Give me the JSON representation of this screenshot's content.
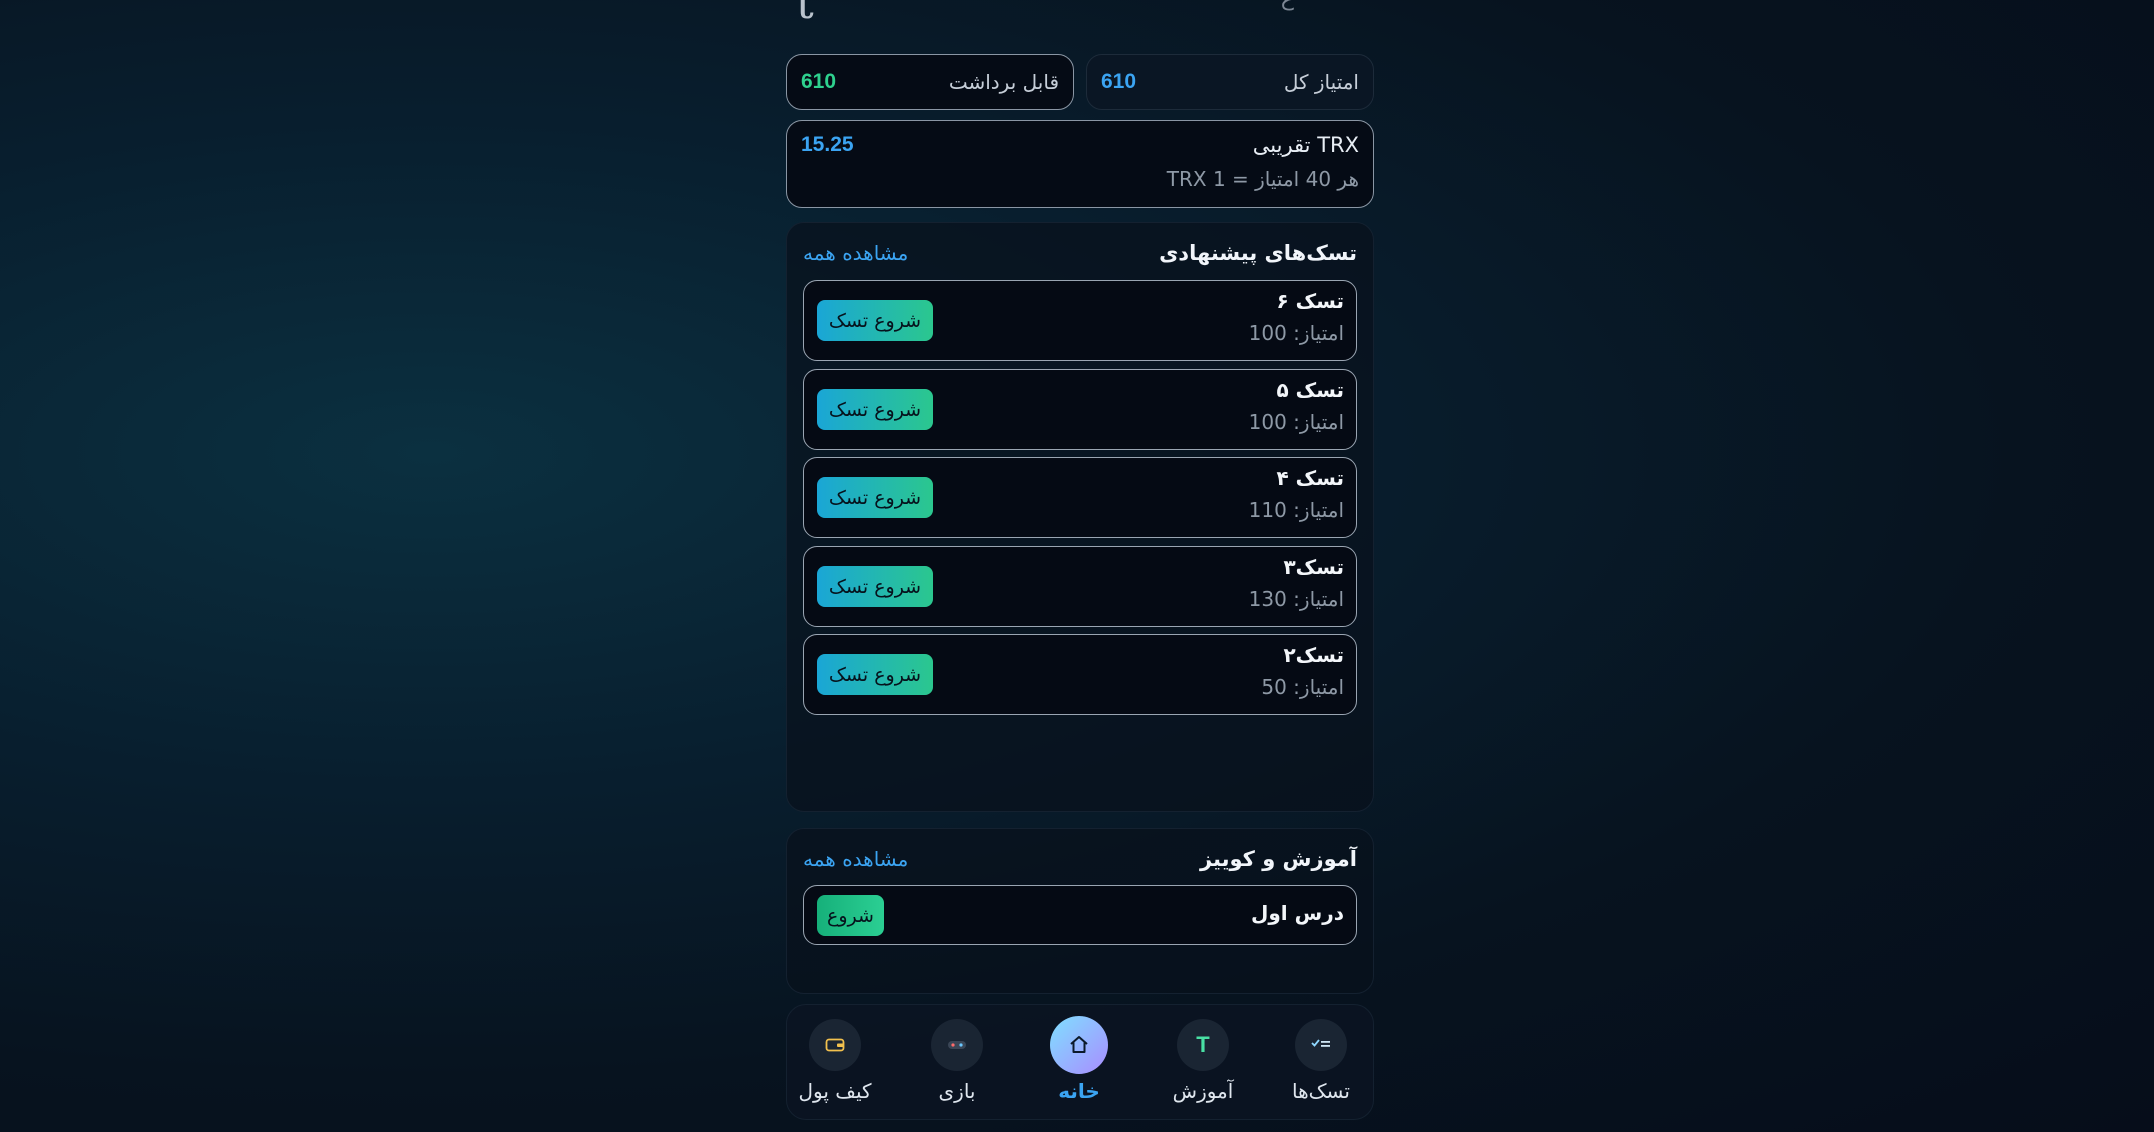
{
  "header": {
    "fragment_left": "t",
    "fragment_right": "ع"
  },
  "stats": {
    "total_label": "امتیاز کل",
    "total_value": "610",
    "withdrawable_label": "قابل برداشت",
    "withdrawable_value": "610"
  },
  "trx": {
    "title": "TRX تقریبی",
    "value": "15.25",
    "rate": "هر 40 امتیاز = 1 TRX"
  },
  "tasks_section": {
    "title": "تسک‌های پیشنهادی",
    "see_all": "مشاهده همه",
    "items": [
      {
        "name": "تسک ۶",
        "points": "امتیاز: 100",
        "button": "شروع تسک"
      },
      {
        "name": "تسک ۵",
        "points": "امتیاز: 100",
        "button": "شروع تسک"
      },
      {
        "name": "تسک ۴",
        "points": "امتیاز: 110",
        "button": "شروع تسک"
      },
      {
        "name": "تسک۳",
        "points": "امتیاز: 130",
        "button": "شروع تسک"
      },
      {
        "name": "تسک۲",
        "points": "امتیاز: 50",
        "button": "شروع تسک"
      }
    ]
  },
  "quiz_section": {
    "title": "آموزش و کوییز",
    "see_all": "مشاهده همه",
    "lesson": {
      "name": "درس اول",
      "button": "شروع"
    }
  },
  "bottom_nav": {
    "active": "home",
    "items": [
      {
        "key": "tasks",
        "label": "تسک‌ها",
        "icon": "tasks-icon"
      },
      {
        "key": "learn",
        "label": "آموزش",
        "icon": "learn-icon"
      },
      {
        "key": "home",
        "label": "خانه",
        "icon": "home-icon"
      },
      {
        "key": "game",
        "label": "بازی",
        "icon": "gamepad-icon"
      },
      {
        "key": "wallet",
        "label": "کیف پول",
        "icon": "wallet-icon"
      }
    ]
  },
  "colors": {
    "accent_blue": "#3ba4f2",
    "accent_green": "#2ed18e",
    "background": "#07131f"
  }
}
